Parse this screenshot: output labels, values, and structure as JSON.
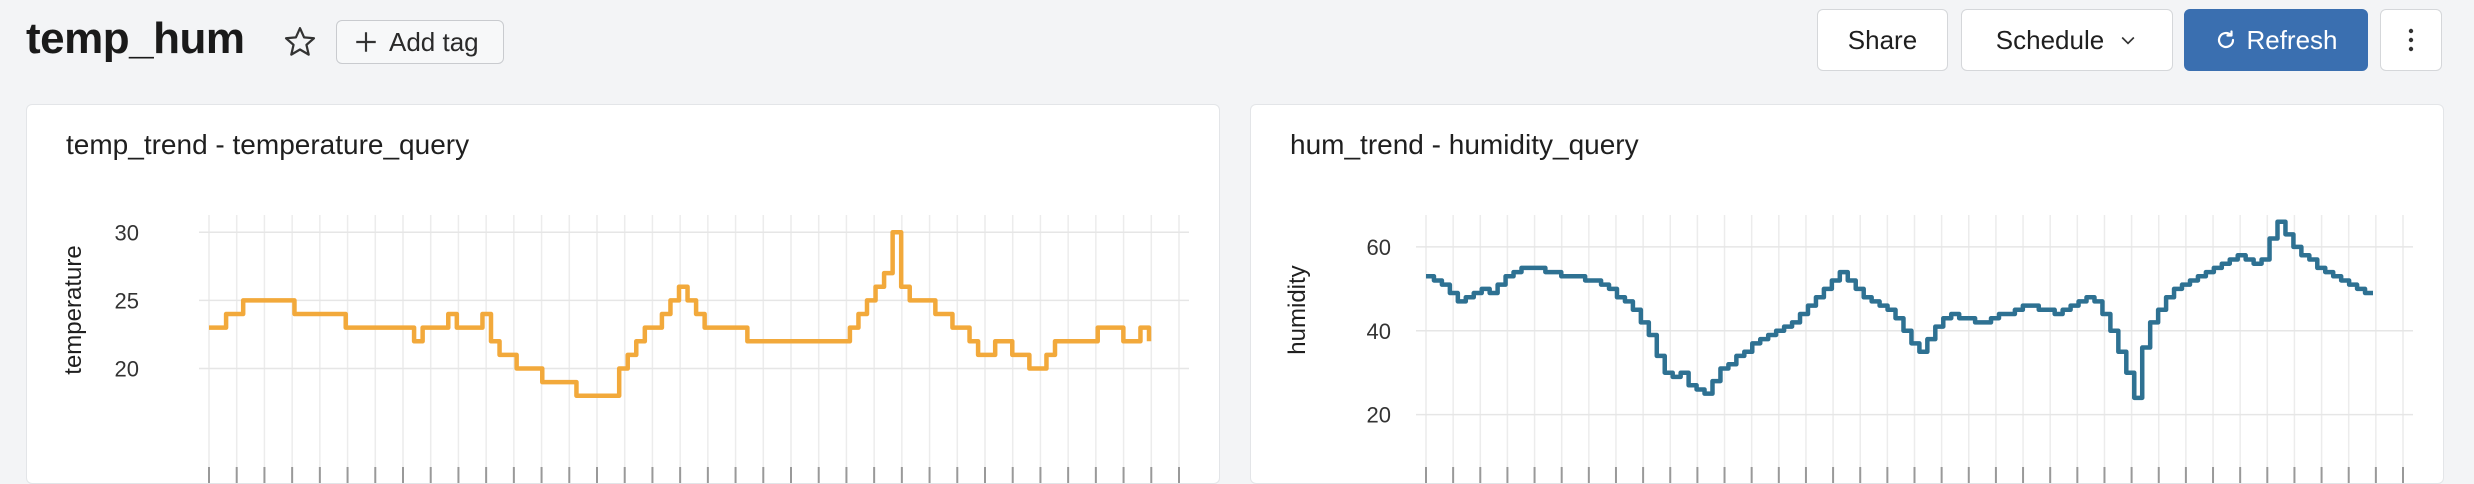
{
  "header": {
    "title": "temp_hum",
    "add_tag_label": "Add tag",
    "share_label": "Share",
    "schedule_label": "Schedule",
    "refresh_label": "Refresh",
    "icons": [
      "star-icon",
      "plus-icon",
      "chevron-down-icon",
      "refresh-icon",
      "kebab-icon"
    ]
  },
  "panels": [
    {
      "title": "temp_trend - temperature_query"
    },
    {
      "title": "hum_trend - humidity_query"
    }
  ],
  "chart_data": [
    {
      "type": "line",
      "title": "temp_trend - temperature_query",
      "ylabel": "temperature",
      "xlabel": "",
      "yticks": [
        20,
        25,
        30
      ],
      "ylim": [
        16,
        32
      ],
      "series": [
        {
          "color": "#f2a93b",
          "values": [
            23,
            23,
            24,
            24,
            25,
            25,
            25,
            25,
            25,
            25,
            24,
            24,
            24,
            24,
            24,
            24,
            23,
            23,
            23,
            23,
            23,
            23,
            23,
            23,
            22,
            23,
            23,
            23,
            24,
            23,
            23,
            23,
            24,
            22,
            21,
            21,
            20,
            20,
            20,
            19,
            19,
            19,
            19,
            18,
            18,
            18,
            18,
            18,
            20,
            21,
            22,
            23,
            23,
            24,
            25,
            26,
            25,
            24,
            23,
            23,
            23,
            23,
            23,
            22,
            22,
            22,
            22,
            22,
            22,
            22,
            22,
            22,
            22,
            22,
            22,
            23,
            24,
            25,
            26,
            27,
            30,
            26,
            25,
            25,
            25,
            24,
            24,
            23,
            23,
            22,
            21,
            21,
            22,
            22,
            21,
            21,
            20,
            20,
            21,
            22,
            22,
            22,
            22,
            22,
            23,
            23,
            23,
            22,
            22,
            23,
            22
          ]
        }
      ],
      "grid": true
    },
    {
      "type": "line",
      "title": "hum_trend - humidity_query",
      "ylabel": "humidity",
      "xlabel": "",
      "yticks": [
        20,
        40,
        60
      ],
      "ylim": [
        18,
        70
      ],
      "series": [
        {
          "color": "#2e7192",
          "values": [
            53,
            52,
            51,
            49,
            47,
            48,
            49,
            50,
            49,
            51,
            53,
            54,
            55,
            55,
            55,
            54,
            54,
            53,
            53,
            53,
            52,
            52,
            51,
            50,
            48,
            47,
            45,
            42,
            39,
            34,
            30,
            29,
            30,
            27,
            26,
            25,
            28,
            31,
            32,
            34,
            35,
            37,
            38,
            39,
            40,
            41,
            42,
            44,
            46,
            48,
            50,
            52,
            54,
            52,
            50,
            48,
            47,
            46,
            45,
            43,
            40,
            37,
            35,
            38,
            41,
            43,
            44,
            43,
            43,
            42,
            42,
            43,
            44,
            44,
            45,
            46,
            46,
            45,
            45,
            44,
            45,
            46,
            47,
            48,
            47,
            44,
            40,
            35,
            30,
            24,
            36,
            42,
            45,
            48,
            50,
            51,
            52,
            53,
            54,
            55,
            56,
            57,
            58,
            57,
            56,
            57,
            62,
            66,
            63,
            60,
            58,
            57,
            55,
            54,
            53,
            52,
            51,
            50,
            49,
            49
          ]
        }
      ],
      "grid": true
    }
  ]
}
